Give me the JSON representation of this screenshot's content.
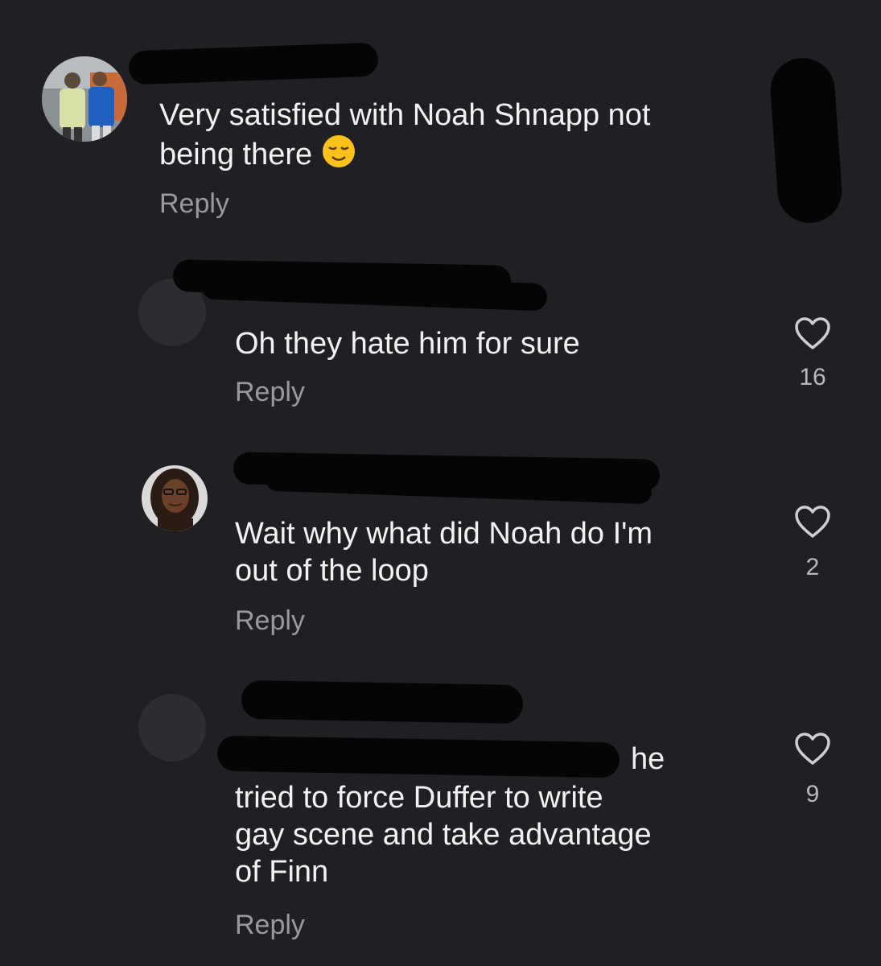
{
  "colors": {
    "background": "#202024",
    "text": "#f2f2f2",
    "muted": "#9a9a9e",
    "redaction": "#050505"
  },
  "comments": [
    {
      "text_lines": [
        "Very satisfied with Noah Shnapp not",
        "being there"
      ],
      "emoji": "relieved-face",
      "reply_label": "Reply"
    },
    {
      "text": "Oh they hate him for sure",
      "reply_label": "Reply",
      "likes": "16"
    },
    {
      "text_lines": [
        "Wait why what did Noah do I'm",
        "out of the loop"
      ],
      "reply_label": "Reply",
      "likes": "2"
    },
    {
      "partial_line": "he",
      "text_lines": [
        "tried to force Duffer to write",
        "gay scene and take advantage",
        "of Finn"
      ],
      "reply_label": "Reply",
      "likes": "9"
    }
  ]
}
